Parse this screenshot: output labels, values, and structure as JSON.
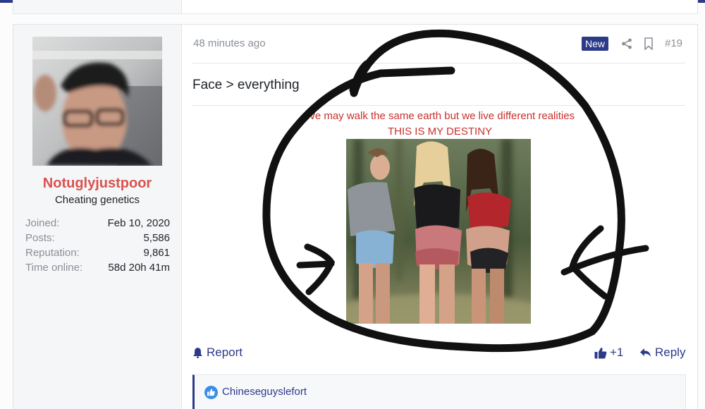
{
  "post": {
    "time": "48 minutes ago",
    "badge": "New",
    "number": "#19",
    "text": "Face > everything",
    "quote_line1": "We may walk the same earth but we live different realities",
    "quote_line2": "THIS IS MY DESTINY"
  },
  "user": {
    "name": "Notuglyjustpoor",
    "title": "Cheating genetics",
    "stats": [
      {
        "label": "Joined:",
        "value": "Feb 10, 2020"
      },
      {
        "label": "Posts:",
        "value": "5,586"
      },
      {
        "label": "Reputation:",
        "value": "9,861"
      },
      {
        "label": "Time online:",
        "value": "58d 20h 41m"
      }
    ]
  },
  "actions": {
    "report": "Report",
    "like_count": "+1",
    "reply": "Reply"
  },
  "likes": {
    "user": "Chineseguyslefort"
  },
  "colors": {
    "accent": "#2c3a8a",
    "username": "#d9534f",
    "quote": "#c9302c"
  },
  "icons": {
    "share": "share-icon",
    "bookmark": "bookmark-icon",
    "report": "bell-icon",
    "like": "thumbs-up-icon",
    "reply": "reply-arrow-icon"
  }
}
